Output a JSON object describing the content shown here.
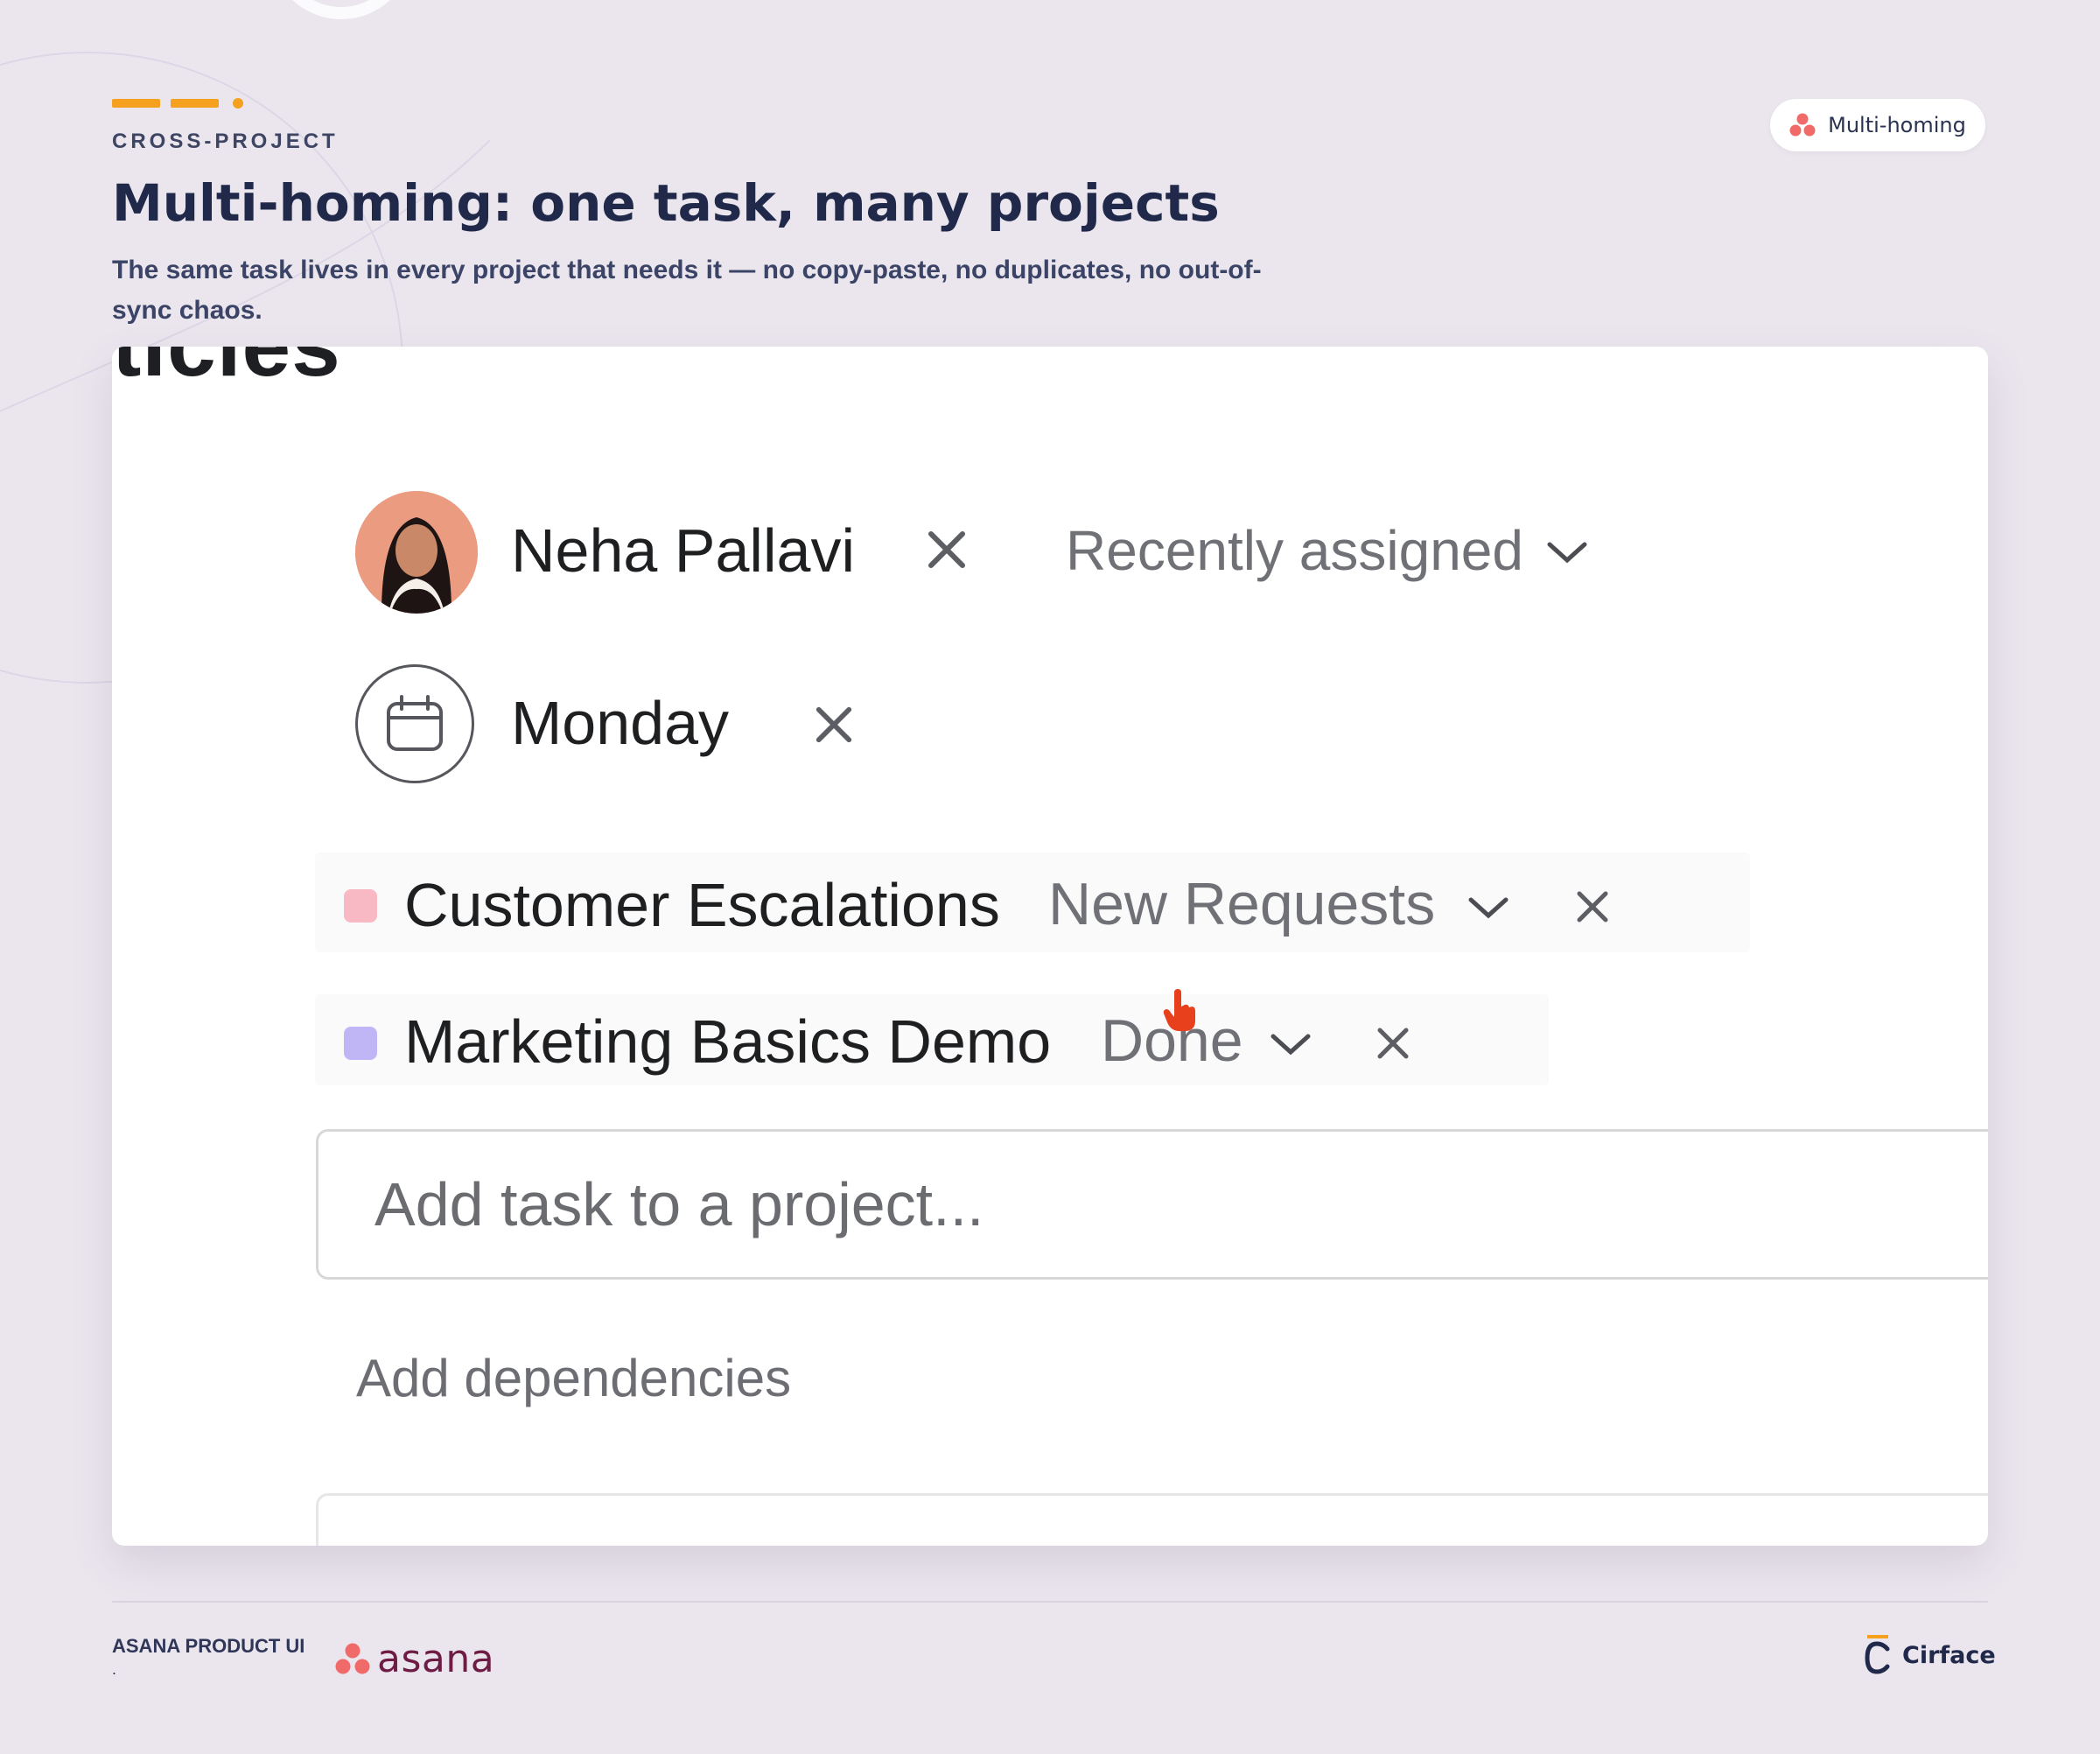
{
  "header": {
    "eyebrow": "CROSS-PROJECT",
    "title": "Multi-homing: one task, many projects",
    "subtitle": "The same task lives in every project that needs it — no copy-paste, no duplicates, no out-of-sync chaos.",
    "badge_label": "Multi-homing",
    "accent_color": "#f5a11f"
  },
  "task_panel": {
    "clipped_heading": "ticles",
    "assignee": {
      "name": "Neha Pallavi",
      "remove_icon": "close-icon",
      "dropdown_label": "Recently assigned"
    },
    "due_date": {
      "label": "Monday",
      "icon": "calendar-icon",
      "remove_icon": "close-icon"
    },
    "projects": [
      {
        "name": "Customer Escalations",
        "section": "New Requests",
        "color": "#f8b8c4"
      },
      {
        "name": "Marketing Basics Demo",
        "section": "Done",
        "color": "#c0b6f6"
      }
    ],
    "add_project_placeholder": "Add task to a project...",
    "add_dependencies_label": "Add dependencies"
  },
  "footer": {
    "source_label": "ASANA PRODUCT UI",
    "source_dot": ".",
    "asana_wordmark": "asana",
    "brand_name": "Cirface"
  }
}
